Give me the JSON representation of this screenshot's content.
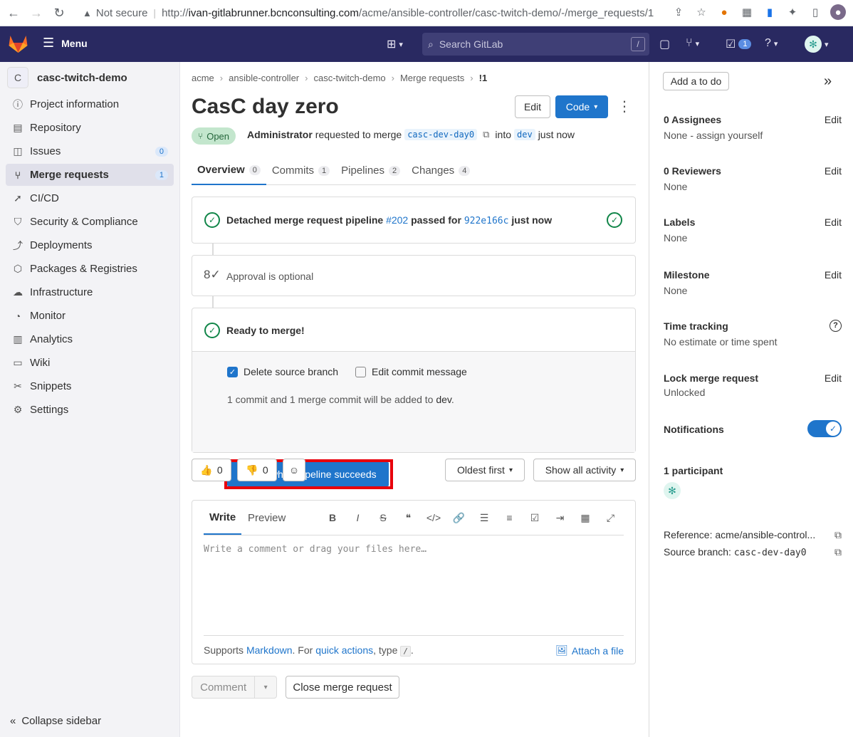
{
  "browser": {
    "security_label": "Not secure",
    "url_scheme": "http://",
    "url_host": "ivan-gitlabrunner.bcnconsulting.com",
    "url_path": "/acme/ansible-controller/casc-twitch-demo/-/merge_requests/1"
  },
  "header": {
    "menu_label": "Menu",
    "search_placeholder": "Search GitLab",
    "search_shortcut": "/",
    "todo_count": "1"
  },
  "sidebar": {
    "project_initial": "C",
    "project_name": "casc-twitch-demo",
    "items": [
      {
        "label": "Project information",
        "icon": "info-icon"
      },
      {
        "label": "Repository",
        "icon": "book-icon"
      },
      {
        "label": "Issues",
        "icon": "issues-icon",
        "count": "0"
      },
      {
        "label": "Merge requests",
        "icon": "merge-request-icon",
        "count": "1"
      },
      {
        "label": "CI/CD",
        "icon": "rocket-icon"
      },
      {
        "label": "Security & Compliance",
        "icon": "shield-icon"
      },
      {
        "label": "Deployments",
        "icon": "deployments-icon"
      },
      {
        "label": "Packages & Registries",
        "icon": "package-icon"
      },
      {
        "label": "Infrastructure",
        "icon": "cloud-icon"
      },
      {
        "label": "Monitor",
        "icon": "monitor-icon"
      },
      {
        "label": "Analytics",
        "icon": "chart-icon"
      },
      {
        "label": "Wiki",
        "icon": "wiki-icon"
      },
      {
        "label": "Snippets",
        "icon": "snippet-icon"
      },
      {
        "label": "Settings",
        "icon": "gear-icon"
      }
    ],
    "collapse_label": "Collapse sidebar"
  },
  "breadcrumb": [
    "acme",
    "ansible-controller",
    "casc-twitch-demo",
    "Merge requests",
    "!1"
  ],
  "mr": {
    "title": "CasC day zero",
    "edit_label": "Edit",
    "code_label": "Code",
    "status": "Open",
    "author": "Administrator",
    "requested_text": "requested to merge",
    "source_branch": "casc-dev-day0",
    "into_text": "into",
    "target_branch": "dev",
    "time": "just now"
  },
  "tabs": [
    {
      "label": "Overview",
      "count": "0"
    },
    {
      "label": "Commits",
      "count": "1"
    },
    {
      "label": "Pipelines",
      "count": "2"
    },
    {
      "label": "Changes",
      "count": "4"
    }
  ],
  "pipeline": {
    "prefix": "Detached merge request pipeline",
    "id": "#202",
    "passed_for": "passed for",
    "sha": "922e166c",
    "time": "just now"
  },
  "approval": {
    "text": "Approval is optional"
  },
  "merge": {
    "ready_text": "Ready to merge!",
    "delete_source_label": "Delete source branch",
    "edit_commit_label": "Edit commit message",
    "commits_info_prefix": "1 commit and 1 merge commit will be added to",
    "commits_info_branch": "dev",
    "button_label": "Merge when pipeline succeeds"
  },
  "reactions": {
    "thumbs_up_count": "0",
    "thumbs_down_count": "0",
    "sort_label": "Oldest first",
    "filter_label": "Show all activity"
  },
  "comment": {
    "write_tab": "Write",
    "preview_tab": "Preview",
    "placeholder": "Write a comment or drag your files here…",
    "supports": "Supports",
    "markdown": "Markdown",
    "for_text": ". For",
    "quick_actions": "quick actions",
    "type_text": ", type",
    "slash": "/",
    "period": ".",
    "attach_label": "Attach a file",
    "comment_button": "Comment",
    "close_button": "Close merge request"
  },
  "right_sidebar": {
    "add_todo": "Add a to do",
    "assignees_title": "0 Assignees",
    "assignees_value": "None - assign yourself",
    "reviewers_title": "0 Reviewers",
    "reviewers_value": "None",
    "labels_title": "Labels",
    "labels_value": "None",
    "milestone_title": "Milestone",
    "milestone_value": "None",
    "time_title": "Time tracking",
    "time_value": "No estimate or time spent",
    "lock_title": "Lock merge request",
    "lock_value": "Unlocked",
    "notifications_title": "Notifications",
    "participants_title": "1 participant",
    "reference": "Reference: acme/ansible-control...",
    "source_branch_label": "Source branch:",
    "source_branch_value": "casc-dev-day0",
    "edit_label": "Edit"
  },
  "colors": {
    "header_bg": "#292961",
    "primary": "#1f75cb",
    "success": "#108548",
    "highlight": "#e8000b"
  }
}
